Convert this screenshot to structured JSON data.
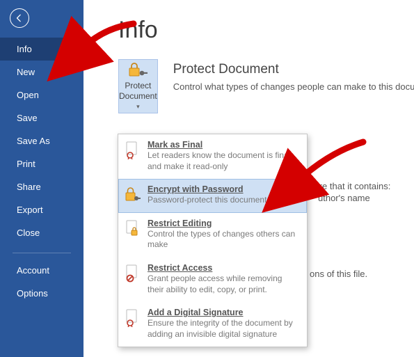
{
  "sidebar": {
    "items": [
      {
        "label": "Info",
        "selected": true
      },
      {
        "label": "New"
      },
      {
        "label": "Open"
      },
      {
        "label": "Save"
      },
      {
        "label": "Save As"
      },
      {
        "label": "Print"
      },
      {
        "label": "Share"
      },
      {
        "label": "Export"
      },
      {
        "label": "Close"
      }
    ],
    "footer": [
      {
        "label": "Account"
      },
      {
        "label": "Options"
      }
    ]
  },
  "page_title": "Info",
  "protect_button": {
    "line1": "Protect",
    "line2": "Document"
  },
  "protect_section": {
    "heading": "Protect Document",
    "desc": "Control what types of changes people can make to this docur"
  },
  "dropdown": [
    {
      "title": "Mark as Final",
      "sub": "Let readers know the document is final and make it read-only",
      "icon": "ribbon-icon"
    },
    {
      "title": "Encrypt with Password",
      "sub": "Password-protect this document",
      "icon": "lock-key-icon",
      "highlight": true
    },
    {
      "title": "Restrict Editing",
      "sub": "Control the types of changes others can make",
      "icon": "doc-lock-icon"
    },
    {
      "title": "Restrict Access",
      "sub": "Grant people access while removing their ability to edit, copy, or print.",
      "icon": "doc-restrict-icon"
    },
    {
      "title": "Add a Digital Signature",
      "sub": "Ensure the integrity of the document by adding an invisible digital signature",
      "icon": "doc-sign-icon"
    }
  ],
  "aside": {
    "line1": "vare that it contains:",
    "bullet1": "uthor's name",
    "line2": "ons of this file."
  }
}
